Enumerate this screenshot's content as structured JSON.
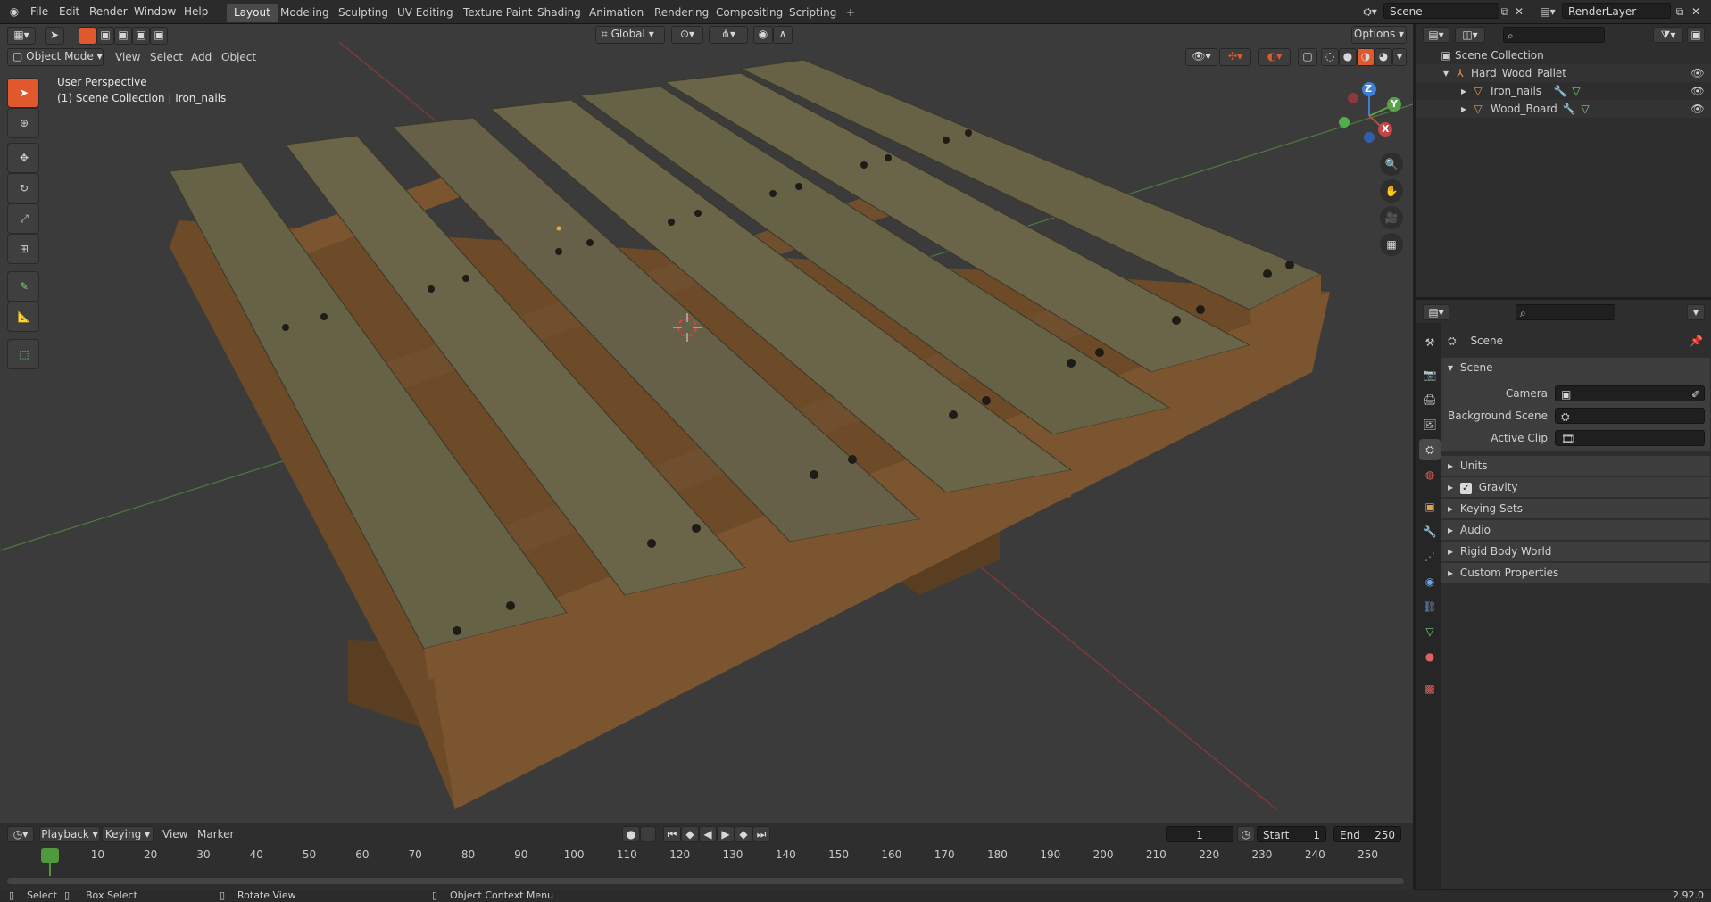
{
  "topbar": {
    "menus": [
      "File",
      "Edit",
      "Render",
      "Window",
      "Help"
    ],
    "workspaces": [
      "Layout",
      "Modeling",
      "Sculpting",
      "UV Editing",
      "Texture Paint",
      "Shading",
      "Animation",
      "Rendering",
      "Compositing",
      "Scripting"
    ],
    "active_workspace": "Layout",
    "add_tab": "+",
    "scene_name": "Scene",
    "view_layer": "RenderLayer"
  },
  "viewport_header": {
    "mode": "Object Mode",
    "menus": [
      "View",
      "Select",
      "Add",
      "Object"
    ],
    "transform_orientation": "Global",
    "options": "Options"
  },
  "viewport_overlay": {
    "perspective": "User Perspective",
    "collection_info": "(1) Scene Collection | Iron_nails"
  },
  "gizmo": {
    "z": "Z",
    "y": "Y",
    "x": "X"
  },
  "outliner": {
    "root": "Scene Collection",
    "items": [
      {
        "name": "Hard_Wood_Pallet",
        "depth": 1
      },
      {
        "name": "Iron_nails",
        "depth": 2
      },
      {
        "name": "Wood_Board",
        "depth": 2
      }
    ]
  },
  "properties": {
    "header": "Scene",
    "section": "Scene",
    "fields": [
      {
        "label": "Camera"
      },
      {
        "label": "Background Scene"
      },
      {
        "label": "Active Clip"
      }
    ],
    "subsections": [
      "Units",
      "Gravity",
      "Keying Sets",
      "Audio",
      "Rigid Body World",
      "Custom Properties"
    ],
    "gravity_checked": true
  },
  "timeline": {
    "menus": [
      "Playback",
      "Keying",
      "View",
      "Marker"
    ],
    "current_frame": "1",
    "start_label": "Start",
    "start": "1",
    "end_label": "End",
    "end": "250",
    "ticks": [
      "1",
      "10",
      "20",
      "30",
      "40",
      "50",
      "60",
      "70",
      "80",
      "90",
      "100",
      "110",
      "120",
      "130",
      "140",
      "150",
      "160",
      "170",
      "180",
      "190",
      "200",
      "210",
      "220",
      "230",
      "240",
      "250"
    ]
  },
  "statusbar": {
    "select": "Select",
    "box_select": "Box Select",
    "rotate_view": "Rotate View",
    "context_menu": "Object Context Menu",
    "version": "2.92.0"
  },
  "colors": {
    "accent": "#e0582c",
    "axis_red": "#c44545",
    "axis_green": "#5aa24a",
    "axis_blue": "#3f7dd6",
    "viewport_bg": "#3b3b3b",
    "wood_top": "#6a6448",
    "wood_side": "#7a5530"
  }
}
